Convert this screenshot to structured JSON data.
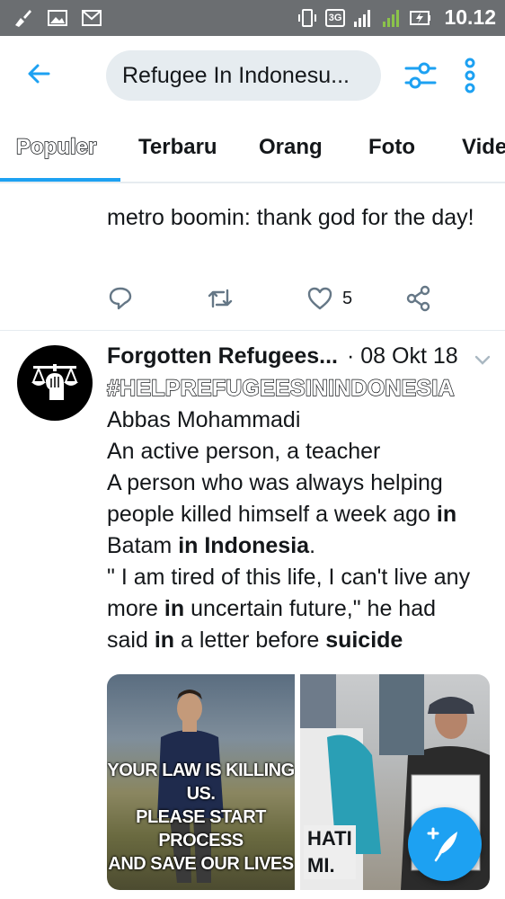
{
  "status_bar": {
    "network": "3G",
    "sim1": "1",
    "sim2": "2",
    "time": "10.12"
  },
  "search": {
    "query": "Refugee In Indonesu..."
  },
  "tabs": [
    {
      "label": "Populer",
      "active": true
    },
    {
      "label": "Terbaru",
      "active": false
    },
    {
      "label": "Orang",
      "active": false
    },
    {
      "label": "Foto",
      "active": false
    },
    {
      "label": "Vide",
      "active": false
    }
  ],
  "prev_tweet": {
    "text": "metro boomin: thank god for the day!",
    "like_count": "5"
  },
  "tweet": {
    "author": "Forgotten Refugees...",
    "date": "· 08 Okt 18",
    "hashtag": "#HELPREFUGEESININDONESIA",
    "lines": {
      "l1": "Abbas Mohammadi",
      "l2": "An active person, a teacher",
      "l3": "A person who was always helping",
      "l4a": "people killed himself a week ago ",
      "l4b": "in",
      "l5a": "Batam ",
      "l5b": "in Indonesia",
      "l5c": ".",
      "l6": "\" I am tired of this life, I can't live any",
      "l7a": "more ",
      "l7b": "in",
      "l7c": " uncertain future,\" he had",
      "l8a": "said ",
      "l8b": "in",
      "l8c": " a letter before ",
      "l8d": "suicide"
    },
    "image1_text": {
      "line1": "YOUR LAW IS KILLING",
      "line2": "US.",
      "line3": "PLEASE START PROCESS",
      "line4": "AND SAVE OUR LIVES"
    },
    "image2_text": {
      "line1": "HATI",
      "line2": "MI."
    }
  },
  "colors": {
    "accent": "#1da1f2",
    "status_bar": "#6b6e71",
    "search_bg": "#e6ecf0"
  },
  "icons": {
    "back": "arrow-left-icon",
    "filter": "sliders-icon",
    "more": "vertical-dots-icon",
    "reply": "reply-icon",
    "retweet": "retweet-icon",
    "like": "heart-icon",
    "share": "share-icon",
    "compose": "compose-feather-icon"
  }
}
